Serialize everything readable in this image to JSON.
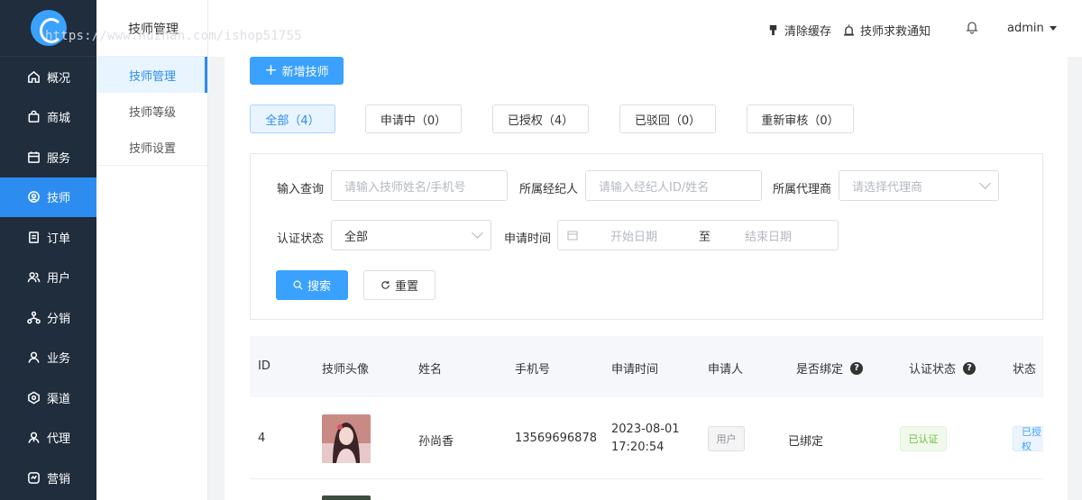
{
  "watermark": "https://www.huzhan.com/ishop51755",
  "sidebar": {
    "items": [
      {
        "label": "概况",
        "icon": "home-icon"
      },
      {
        "label": "商城",
        "icon": "shop-bag-icon"
      },
      {
        "label": "服务",
        "icon": "service-icon"
      },
      {
        "label": "技师",
        "icon": "technician-icon"
      },
      {
        "label": "订单",
        "icon": "order-icon"
      },
      {
        "label": "用户",
        "icon": "users-icon"
      },
      {
        "label": "分销",
        "icon": "distribution-icon"
      },
      {
        "label": "业务",
        "icon": "business-icon"
      },
      {
        "label": "渠道",
        "icon": "channel-icon"
      },
      {
        "label": "代理",
        "icon": "agent-icon"
      },
      {
        "label": "营销",
        "icon": "marketing-icon"
      }
    ],
    "active_index": 3,
    "accent": "#2d8cf0"
  },
  "subsidebar": {
    "title": "技师管理",
    "items": [
      "技师管理",
      "技师等级",
      "技师设置"
    ]
  },
  "header": {
    "clear_cache": "清除缓存",
    "sos_notice": "技师求救通知",
    "user": "admin"
  },
  "main": {
    "add_button": "新增技师",
    "tabs": [
      "全部（4）",
      "申请中（0）",
      "已授权（4）",
      "已驳回（0）",
      "重新审核（0）"
    ],
    "filters": {
      "query_label": "输入查询",
      "query_placeholder": "请输入技师姓名/手机号",
      "broker_label": "所属经纪人",
      "broker_placeholder": "请输入经纪人ID/姓名",
      "agent_label": "所属代理商",
      "agent_placeholder": "请选择代理商",
      "status_label": "认证状态",
      "status_value": "全部",
      "time_label": "申请时间",
      "start_placeholder": "开始日期",
      "range_sep": "至",
      "end_placeholder": "结束日期",
      "search_button": "搜索",
      "reset_button": "重置"
    },
    "table": {
      "columns": [
        "ID",
        "技师头像",
        "姓名",
        "手机号",
        "申请时间",
        "申请人",
        "是否绑定",
        "认证状态",
        "状态"
      ],
      "rows": [
        {
          "id": "4",
          "name": "孙尚香",
          "phone": "13569696878",
          "date": "2023-08-01",
          "time": "17:20:54",
          "applicant": "用户",
          "bound": "已绑定",
          "auth_status": "已认证",
          "status": "已授权"
        }
      ]
    }
  }
}
